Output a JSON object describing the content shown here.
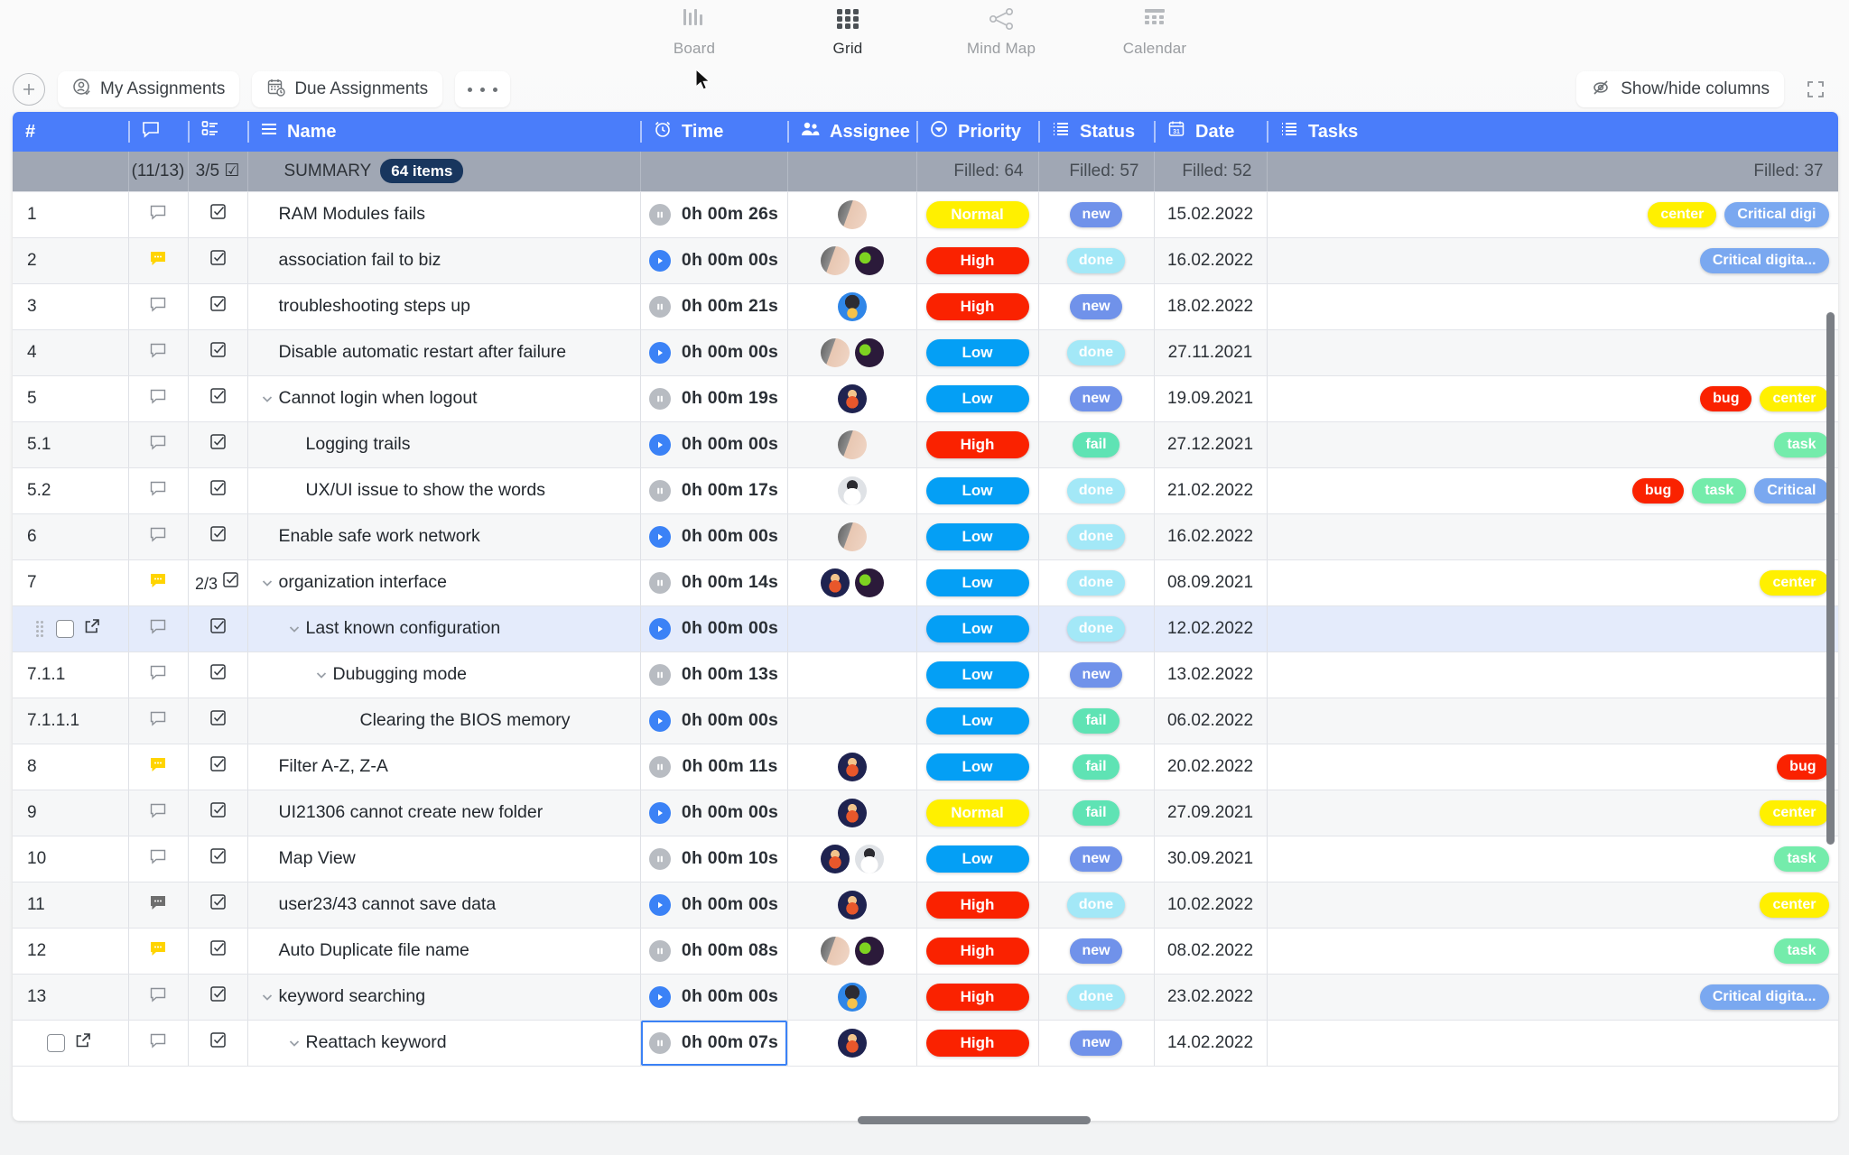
{
  "views": [
    {
      "label": "Board",
      "icon": "board-icon",
      "active": false
    },
    {
      "label": "Grid",
      "icon": "grid-icon",
      "active": true
    },
    {
      "label": "Mind Map",
      "icon": "mindmap-icon",
      "active": false
    },
    {
      "label": "Calendar",
      "icon": "calendar-icon",
      "active": false
    }
  ],
  "toolbar": {
    "add_label": "+",
    "my_assignments": "My Assignments",
    "due_assignments": "Due Assignments",
    "more_label": "...",
    "show_hide_columns": "Show/hide columns",
    "fullscreen_icon": "expand-icon"
  },
  "columns": [
    {
      "key": "num",
      "label": "#",
      "icon": null
    },
    {
      "key": "comment",
      "label": "",
      "icon": "comment-icon"
    },
    {
      "key": "checklist",
      "label": "",
      "icon": "checklist-icon"
    },
    {
      "key": "name",
      "label": "Name",
      "icon": "menu-icon"
    },
    {
      "key": "time",
      "label": "Time",
      "icon": "clock-icon"
    },
    {
      "key": "assignee",
      "label": "Assignee",
      "icon": "people-icon"
    },
    {
      "key": "priority",
      "label": "Priority",
      "icon": "circle-chevron-icon"
    },
    {
      "key": "status",
      "label": "Status",
      "icon": "list-icon"
    },
    {
      "key": "date",
      "label": "Date",
      "icon": "calendar-icon"
    },
    {
      "key": "tasks",
      "label": "Tasks",
      "icon": "list-icon"
    }
  ],
  "summary": {
    "comment": "(11/13)",
    "checklist": "3/5",
    "name_label": "SUMMARY",
    "items_badge": "64 items",
    "priority": "Filled: 64",
    "status": "Filled: 57",
    "date": "Filled: 52",
    "tasks": "Filled: 37"
  },
  "rows": [
    {
      "num": "1",
      "comment": "empty",
      "name": "RAM Modules fails",
      "indent": 0,
      "chevron": false,
      "time": "0h 00m 26s",
      "timer": "pause",
      "avatars": [
        "a1"
      ],
      "priority": "Normal",
      "priority_class": "normal",
      "status": "new",
      "date": "15.02.2022",
      "tags": [
        {
          "text": "center",
          "cls": "center"
        },
        {
          "text": "Critical digi",
          "cls": "crit"
        }
      ]
    },
    {
      "num": "2",
      "comment": "yellow",
      "name": "association fail to biz",
      "indent": 0,
      "chevron": false,
      "time": "0h 00m 00s",
      "timer": "play",
      "avatars": [
        "a1",
        "a2"
      ],
      "priority": "High",
      "priority_class": "high",
      "status": "done",
      "date": "16.02.2022",
      "tags": [
        {
          "text": "Critical digita...",
          "cls": "crit"
        }
      ]
    },
    {
      "num": "3",
      "comment": "empty",
      "name": "troubleshooting steps up",
      "indent": 0,
      "chevron": false,
      "time": "0h 00m 21s",
      "timer": "pause",
      "avatars": [
        "a3"
      ],
      "priority": "High",
      "priority_class": "high",
      "status": "new",
      "date": "18.02.2022",
      "tags": []
    },
    {
      "num": "4",
      "comment": "empty",
      "name": "Disable automatic restart after failure",
      "indent": 0,
      "chevron": false,
      "time": "0h 00m 00s",
      "timer": "play",
      "avatars": [
        "a1",
        "a2"
      ],
      "priority": "Low",
      "priority_class": "low",
      "status": "done",
      "date": "27.11.2021",
      "tags": []
    },
    {
      "num": "5",
      "comment": "empty",
      "name": "Cannot login when logout",
      "indent": 0,
      "chevron": true,
      "time": "0h 00m 19s",
      "timer": "pause",
      "avatars": [
        "a4"
      ],
      "priority": "Low",
      "priority_class": "low",
      "status": "new",
      "date": "19.09.2021",
      "tags": [
        {
          "text": "bug",
          "cls": "bug"
        },
        {
          "text": "center",
          "cls": "center"
        }
      ]
    },
    {
      "num": "5.1",
      "comment": "empty",
      "name": "Logging trails",
      "indent": 1,
      "chevron": false,
      "time": "0h 00m 00s",
      "timer": "play",
      "avatars": [
        "a1"
      ],
      "priority": "High",
      "priority_class": "high",
      "status": "fail",
      "date": "27.12.2021",
      "tags": [
        {
          "text": "task",
          "cls": "task"
        }
      ]
    },
    {
      "num": "5.2",
      "comment": "empty",
      "name": "UX/UI issue to show the words",
      "indent": 1,
      "chevron": false,
      "time": "0h 00m 17s",
      "timer": "pause",
      "avatars": [
        "a5"
      ],
      "priority": "Low",
      "priority_class": "low",
      "status": "done",
      "date": "21.02.2022",
      "tags": [
        {
          "text": "bug",
          "cls": "bug"
        },
        {
          "text": "task",
          "cls": "task"
        },
        {
          "text": "Critical",
          "cls": "crit"
        }
      ]
    },
    {
      "num": "6",
      "comment": "empty",
      "name": "Enable safe work network",
      "indent": 0,
      "chevron": false,
      "time": "0h 00m 00s",
      "timer": "play",
      "avatars": [
        "a1"
      ],
      "priority": "Low",
      "priority_class": "low",
      "status": "done",
      "date": "16.02.2022",
      "tags": []
    },
    {
      "num": "7",
      "comment": "yellow",
      "checklist": "2/3",
      "name": "organization interface",
      "indent": 0,
      "chevron": true,
      "time": "0h 00m 14s",
      "timer": "pause",
      "avatars": [
        "a4",
        "a2"
      ],
      "priority": "Low",
      "priority_class": "low",
      "status": "done",
      "date": "08.09.2021",
      "tags": [
        {
          "text": "center",
          "cls": "center"
        }
      ]
    },
    {
      "num": "",
      "selected": true,
      "handle": true,
      "comment": "empty",
      "name": "Last known configuration",
      "indent": 1,
      "chevron": true,
      "time": "0h 00m 00s",
      "timer": "play",
      "avatars": [],
      "priority": "Low",
      "priority_class": "low",
      "status": "done",
      "date": "12.02.2022",
      "tags": []
    },
    {
      "num": "7.1.1",
      "comment": "empty",
      "name": "Dubugging mode",
      "indent": 2,
      "chevron": true,
      "time": "0h 00m 13s",
      "timer": "pause",
      "avatars": [],
      "priority": "Low",
      "priority_class": "low",
      "status": "new",
      "date": "13.02.2022",
      "tags": []
    },
    {
      "num": "7.1.1.1",
      "comment": "empty",
      "name": "Clearing the BIOS memory",
      "indent": 3,
      "chevron": false,
      "time": "0h 00m 00s",
      "timer": "play",
      "avatars": [],
      "priority": "Low",
      "priority_class": "low",
      "status": "fail",
      "date": "06.02.2022",
      "tags": []
    },
    {
      "num": "8",
      "comment": "yellow",
      "name": "Filter A-Z, Z-A",
      "indent": 0,
      "chevron": false,
      "time": "0h 00m 11s",
      "timer": "pause",
      "avatars": [
        "a4"
      ],
      "priority": "Low",
      "priority_class": "low",
      "status": "fail",
      "date": "20.02.2022",
      "tags": [
        {
          "text": "bug",
          "cls": "bug"
        }
      ]
    },
    {
      "num": "9",
      "comment": "empty",
      "name": "UI21306 cannot create new folder",
      "indent": 0,
      "chevron": false,
      "time": "0h 00m 00s",
      "timer": "play",
      "avatars": [
        "a4"
      ],
      "priority": "Normal",
      "priority_class": "normal",
      "status": "fail",
      "date": "27.09.2021",
      "tags": [
        {
          "text": "center",
          "cls": "center"
        }
      ]
    },
    {
      "num": "10",
      "comment": "empty",
      "name": "Map View",
      "indent": 0,
      "chevron": false,
      "time": "0h 00m 10s",
      "timer": "pause",
      "avatars": [
        "a4",
        "a5"
      ],
      "priority": "Low",
      "priority_class": "low",
      "status": "new",
      "date": "30.09.2021",
      "tags": [
        {
          "text": "task",
          "cls": "task"
        }
      ]
    },
    {
      "num": "11",
      "comment": "dark",
      "name": "user23/43 cannot save data",
      "indent": 0,
      "chevron": false,
      "time": "0h 00m 00s",
      "timer": "play",
      "avatars": [
        "a4"
      ],
      "priority": "High",
      "priority_class": "high",
      "status": "done",
      "date": "10.02.2022",
      "tags": [
        {
          "text": "center",
          "cls": "center"
        }
      ]
    },
    {
      "num": "12",
      "comment": "yellow",
      "name": "Auto Duplicate file name",
      "indent": 0,
      "chevron": false,
      "time": "0h 00m 08s",
      "timer": "pause",
      "avatars": [
        "a1",
        "a2"
      ],
      "priority": "High",
      "priority_class": "high",
      "status": "new",
      "date": "08.02.2022",
      "tags": [
        {
          "text": "task",
          "cls": "task"
        }
      ]
    },
    {
      "num": "13",
      "comment": "empty",
      "name": "keyword searching",
      "indent": 0,
      "chevron": true,
      "time": "0h 00m 00s",
      "timer": "play",
      "avatars": [
        "a3"
      ],
      "priority": "High",
      "priority_class": "high",
      "status": "done",
      "date": "23.02.2022",
      "tags": [
        {
          "text": "Critical digita...",
          "cls": "crit"
        }
      ]
    },
    {
      "num": "",
      "handle_last": true,
      "comment": "empty",
      "name": "Reattach keyword",
      "indent": 1,
      "chevron": true,
      "time": "0h 00m 07s",
      "timer": "pause",
      "time_selected": true,
      "avatars": [
        "a4"
      ],
      "priority": "High",
      "priority_class": "high",
      "status": "new",
      "date": "14.02.2022",
      "tags": []
    }
  ],
  "colors": {
    "header_blue": "#4a7dfa",
    "summary_gray": "#a0a7b4",
    "priority_high": "#fa2200",
    "priority_low": "#049ff5",
    "priority_normal": "#fff000",
    "status_new": "#7092ea",
    "status_done": "#a3e8f7",
    "status_fail": "#5fe3b4",
    "selected_row": "#e4ebfb"
  }
}
